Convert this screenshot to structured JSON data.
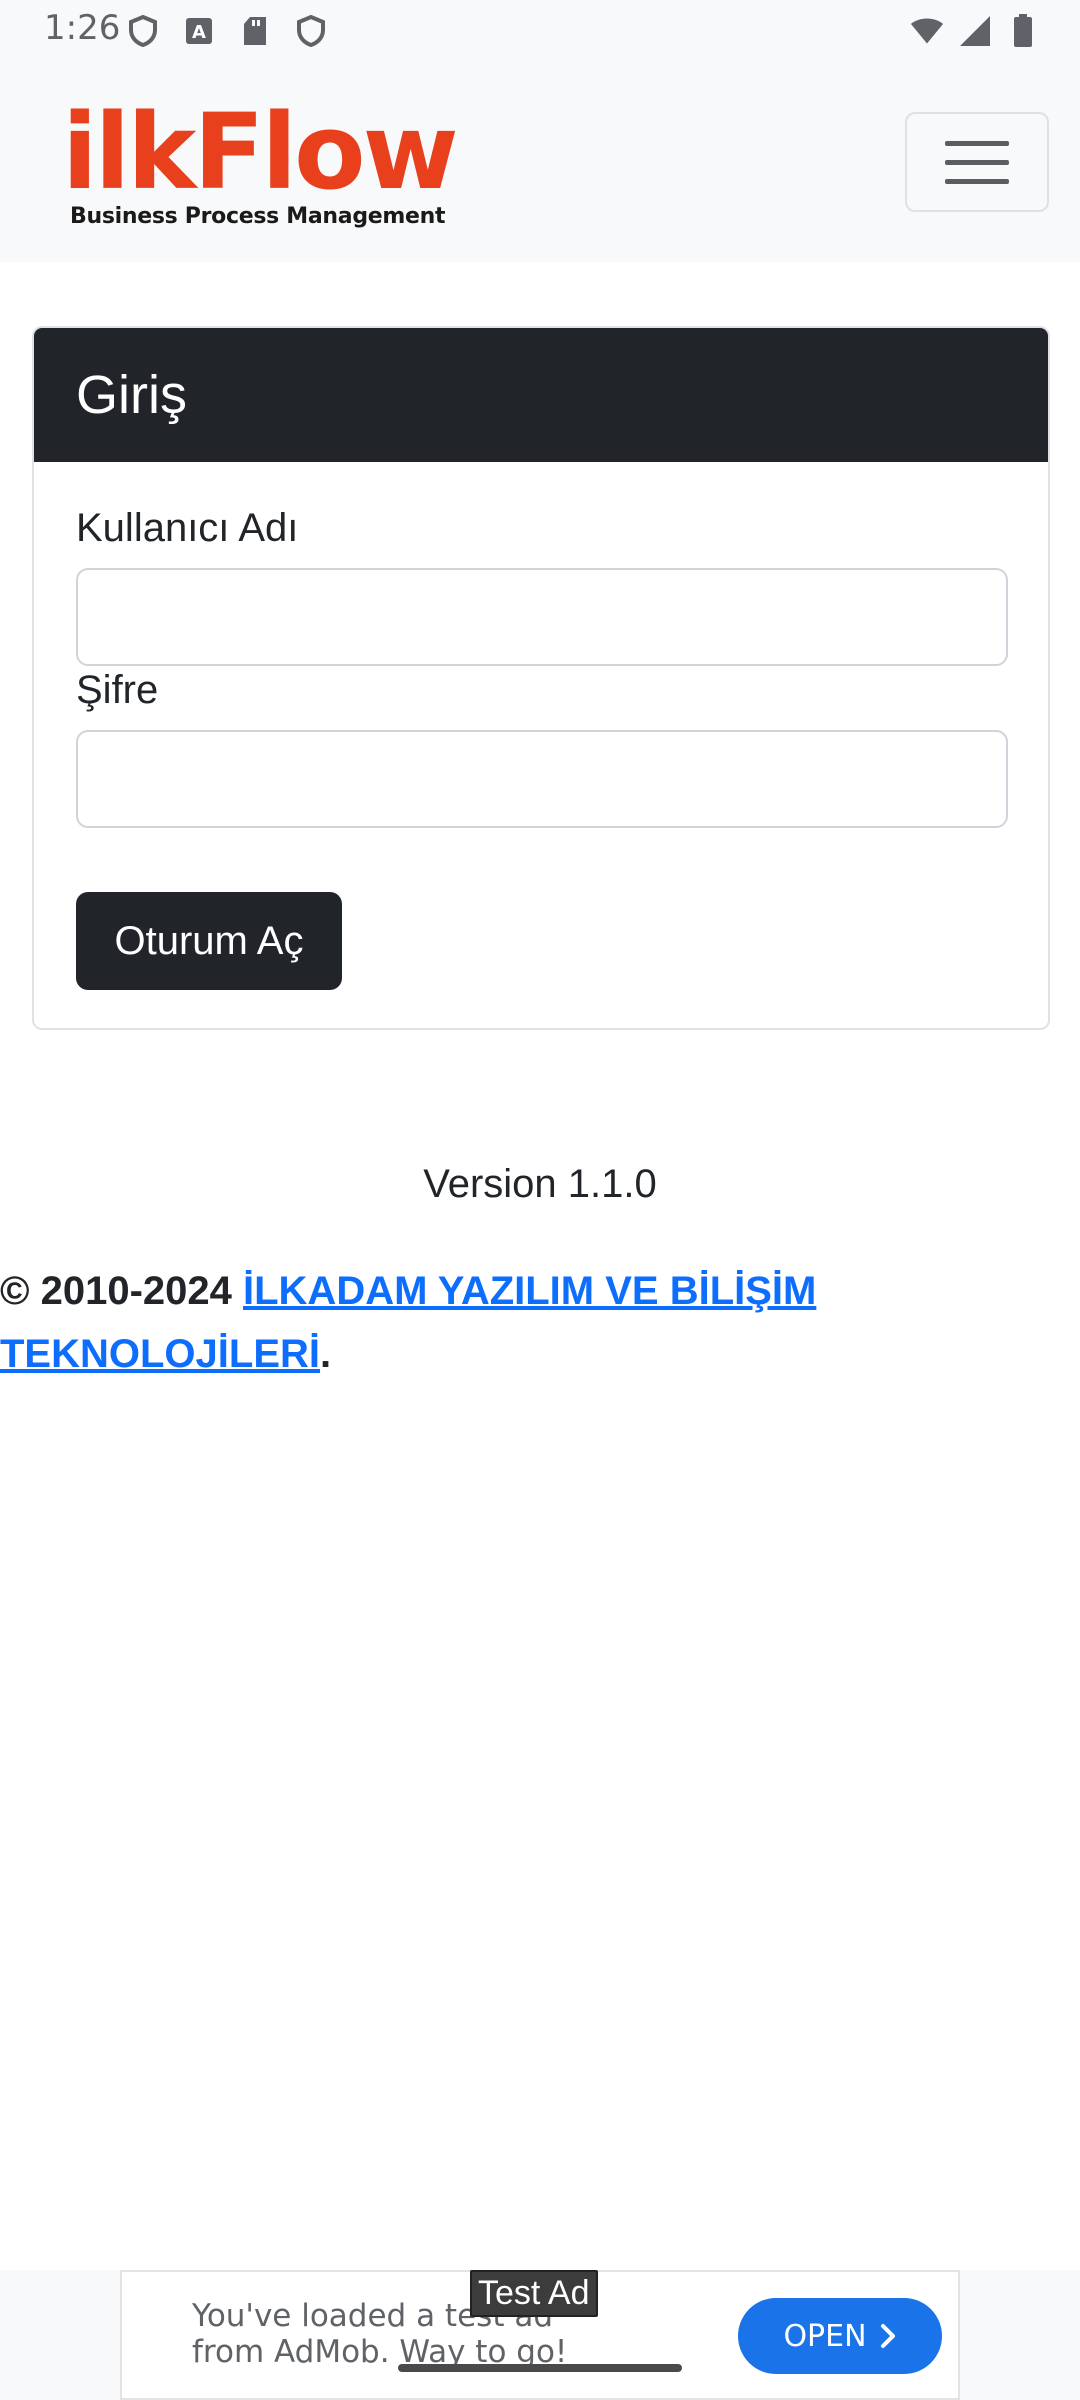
{
  "status_bar": {
    "time": "1:26",
    "icons_left": [
      "shield-icon",
      "font-a-icon",
      "sd-card-icon",
      "shield-icon"
    ],
    "icons_right": [
      "wifi-icon",
      "signal-icon",
      "battery-icon"
    ]
  },
  "navbar": {
    "brand_name": "ilkFlow",
    "brand_tagline": "Business Process Management",
    "brand_color": "#e8401c",
    "menu_icon": "hamburger-icon"
  },
  "login_card": {
    "title": "Giriş",
    "username_label": "Kullanıcı Adı",
    "username_value": "",
    "password_label": "Şifre",
    "password_value": "",
    "submit_label": "Oturum Aç"
  },
  "footer": {
    "version": "Version 1.1.0",
    "copyright_prefix": "© 2010-2024",
    "company_link": "İLKADAM YAZILIM VE BİLİŞİM TEKNOLOJİLERİ",
    "copyright_suffix": ".",
    "link_color": "#0d6efd"
  },
  "ad": {
    "tag": "Test Ad",
    "text": "You've loaded a test ad from AdMob. Way to go!",
    "button_label": "OPEN",
    "button_color": "#1a73e8"
  }
}
